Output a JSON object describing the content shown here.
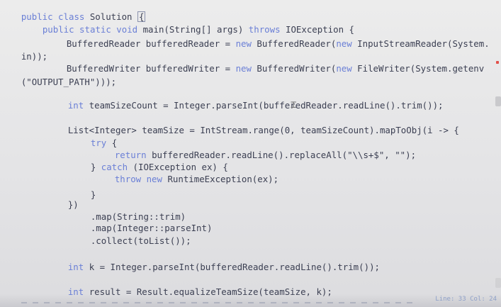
{
  "code": {
    "l1_kw": "public class",
    "l1_id": " Solution ",
    "l1_brace": "{",
    "l2_kw1": "public static void",
    "l2_id": " main(String[] args) ",
    "l2_kw2": "throws",
    "l2_rest": " IOException {",
    "l3_a": "BufferedReader bufferedReader = ",
    "l3_new": "new",
    "l3_b": " BufferedReader(",
    "l3_new2": "new",
    "l3_c": " InputStreamReader(System.",
    "l4": "in));",
    "l5_a": "BufferedWriter bufferedWriter = ",
    "l5_new": "new",
    "l5_b": " BufferedWriter(",
    "l5_new2": "new",
    "l5_c": " FileWriter(System.getenv",
    "l6": "(\"OUTPUT_PATH\")));",
    "l7_kw": "int",
    "l7_rest": " teamSizeCount = Integer.parseInt(bufferedReader.readLine().trim());",
    "l8": "List<Integer> teamSize = IntStream.range(0, teamSizeCount).mapToObj(i -> {",
    "l9_kw": "try",
    "l9_rest": " {",
    "l10_kw": "return",
    "l10_rest": " bufferedReader.readLine().replaceAll(\"\\\\s+$\", \"\");",
    "l11_a": "} ",
    "l11_kw": "catch",
    "l11_rest": " (IOException ex) {",
    "l12_kw": "throw new",
    "l12_rest": " RuntimeException(ex);",
    "l13": "}",
    "l14": "})",
    "l15": ".map(String::trim)",
    "l16": ".map(Integer::parseInt)",
    "l17": ".collect(toList());",
    "l18_kw": "int",
    "l18_rest": " k = Integer.parseInt(bufferedReader.readLine().trim());",
    "l19_kw": "int",
    "l19_rest": " result = Result.equalizeTeamSize(teamSize, k);"
  },
  "status": {
    "line_col": "Line: 33 Col: 24"
  },
  "colors": {
    "keyword": "#6a7fd6",
    "identifier": "#3b3f52",
    "marker": "#e2504a",
    "status": "#8ea0c8"
  }
}
